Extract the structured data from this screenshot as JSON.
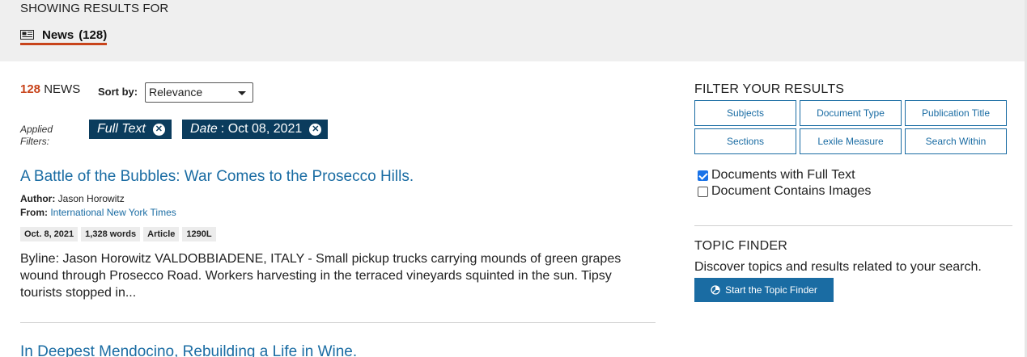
{
  "header": {
    "showing_label": "SHOWING RESULTS FOR",
    "tab": {
      "label": "News",
      "count": "(128)",
      "icon": "newspaper-icon"
    }
  },
  "results": {
    "count_number": "128",
    "count_label": "NEWS",
    "sort_label": "Sort by:",
    "sort_value": "Relevance",
    "applied_label": "Applied Filters:",
    "filters": [
      {
        "label": "Full Text",
        "value": ""
      },
      {
        "label": "Date",
        "value": ": Oct 08, 2021"
      }
    ],
    "items": [
      {
        "title": "A Battle of the Bubbles: War Comes to the Prosecco Hills.",
        "author_label": "Author:",
        "author": "Jason Horowitz",
        "from_label": "From:",
        "source": "International New York Times",
        "badges": [
          "Oct. 8, 2021",
          "1,328 words",
          "Article",
          "1290L"
        ],
        "snippet": "Byline: Jason Horowitz VALDOBBIADENE, ITALY - Small pickup trucks carrying mounds of green grapes wound through Prosecco Road. Workers harvesting in the terraced vineyards squinted in the sun. Tipsy tourists stopped in..."
      },
      {
        "title": "In Deepest Mendocino, Rebuilding a Life in Wine."
      }
    ]
  },
  "filters_panel": {
    "heading": "FILTER YOUR RESULTS",
    "buttons": [
      "Subjects",
      "Document Type",
      "Publication Title",
      "Sections",
      "Lexile Measure",
      "Search Within"
    ],
    "checkboxes": [
      {
        "label": "Documents with Full Text",
        "checked": true
      },
      {
        "label": "Document Contains Images",
        "checked": false
      }
    ]
  },
  "topic_finder": {
    "heading": "TOPIC FINDER",
    "description": "Discover topics and results related to your search.",
    "button": "Start the Topic Finder"
  },
  "colors": {
    "accent": "#c8441b",
    "link": "#1a6ca3",
    "chip_bg": "#0b3c5d",
    "band_bg": "#efefef"
  }
}
